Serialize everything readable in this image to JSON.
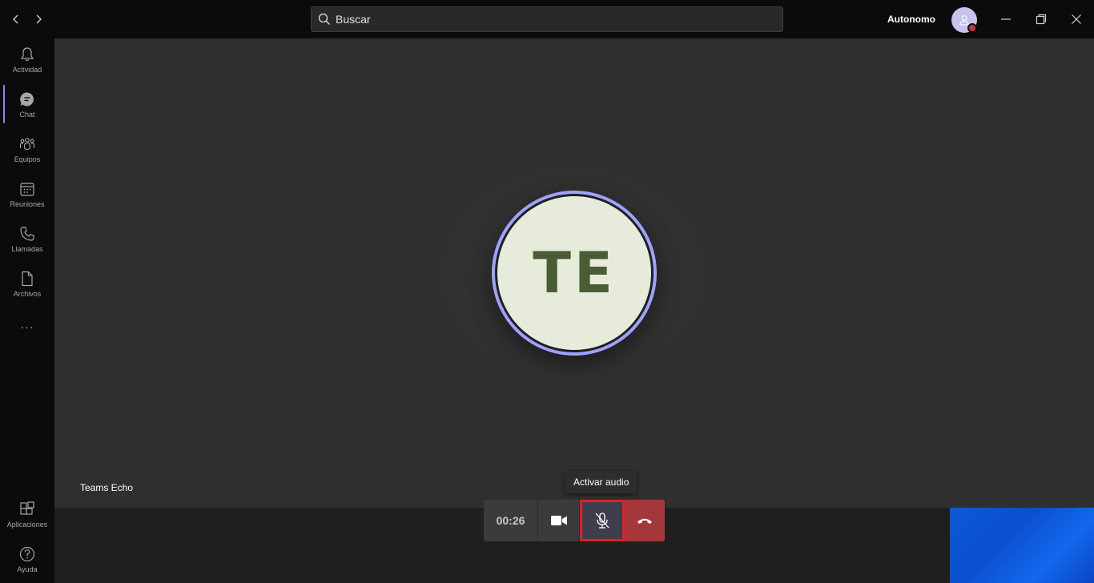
{
  "titlebar": {
    "back_icon": "chevron-left-icon",
    "forward_icon": "chevron-right-icon",
    "search_placeholder": "Buscar",
    "account_name": "Autonomo",
    "status_color": "#c4314b"
  },
  "rail": {
    "items": [
      {
        "label": "Actividad",
        "icon": "bell-icon"
      },
      {
        "label": "Chat",
        "icon": "chat-icon",
        "active": true
      },
      {
        "label": "Equipos",
        "icon": "teams-icon"
      },
      {
        "label": "Reuniones",
        "icon": "calendar-icon"
      },
      {
        "label": "Llamadas",
        "icon": "phone-icon"
      },
      {
        "label": "Archivos",
        "icon": "file-icon"
      }
    ],
    "more_label": "···",
    "bottom_items": [
      {
        "label": "Aplicaciones",
        "icon": "apps-icon"
      },
      {
        "label": "Ayuda",
        "icon": "help-icon"
      }
    ],
    "active_color": "#7f85f5"
  },
  "call": {
    "participant_initials": "TE",
    "participant_name": "Teams Echo",
    "ring_color": "#9ea2ff",
    "avatar_bg": "#e6ebdb",
    "initials_color": "#4a5c33"
  },
  "controls": {
    "timer": "00:26",
    "video_icon": "video-camera-icon",
    "mic_icon": "mic-off-icon",
    "hangup_icon": "hang-up-icon",
    "tooltip": "Activar audio",
    "hangup_color": "#a4373a",
    "highlight_color": "#e41e25"
  }
}
